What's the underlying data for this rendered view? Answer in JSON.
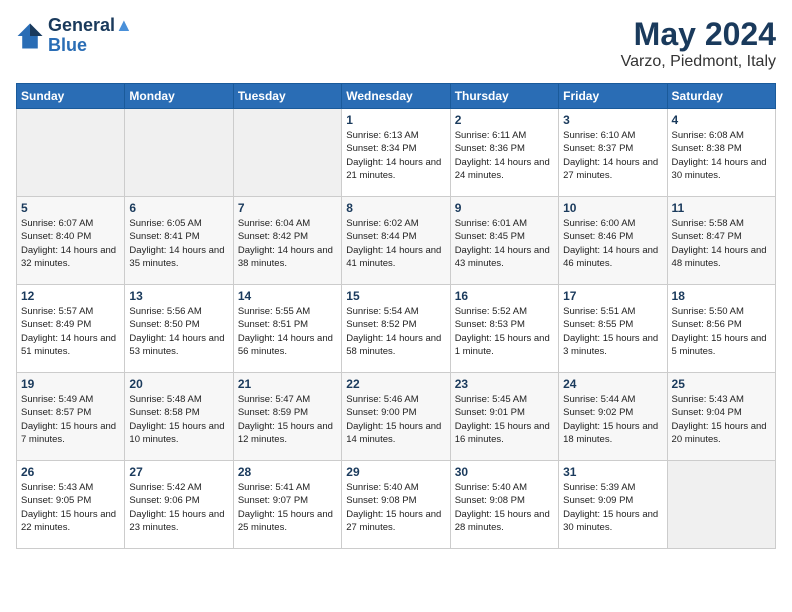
{
  "header": {
    "logo_line1": "General",
    "logo_line2": "Blue",
    "month": "May 2024",
    "location": "Varzo, Piedmont, Italy"
  },
  "days_of_week": [
    "Sunday",
    "Monday",
    "Tuesday",
    "Wednesday",
    "Thursday",
    "Friday",
    "Saturday"
  ],
  "weeks": [
    [
      {
        "day": "",
        "empty": true
      },
      {
        "day": "",
        "empty": true
      },
      {
        "day": "",
        "empty": true
      },
      {
        "day": "1",
        "sunrise": "6:13 AM",
        "sunset": "8:34 PM",
        "daylight": "14 hours and 21 minutes."
      },
      {
        "day": "2",
        "sunrise": "6:11 AM",
        "sunset": "8:36 PM",
        "daylight": "14 hours and 24 minutes."
      },
      {
        "day": "3",
        "sunrise": "6:10 AM",
        "sunset": "8:37 PM",
        "daylight": "14 hours and 27 minutes."
      },
      {
        "day": "4",
        "sunrise": "6:08 AM",
        "sunset": "8:38 PM",
        "daylight": "14 hours and 30 minutes."
      }
    ],
    [
      {
        "day": "5",
        "sunrise": "6:07 AM",
        "sunset": "8:40 PM",
        "daylight": "14 hours and 32 minutes."
      },
      {
        "day": "6",
        "sunrise": "6:05 AM",
        "sunset": "8:41 PM",
        "daylight": "14 hours and 35 minutes."
      },
      {
        "day": "7",
        "sunrise": "6:04 AM",
        "sunset": "8:42 PM",
        "daylight": "14 hours and 38 minutes."
      },
      {
        "day": "8",
        "sunrise": "6:02 AM",
        "sunset": "8:44 PM",
        "daylight": "14 hours and 41 minutes."
      },
      {
        "day": "9",
        "sunrise": "6:01 AM",
        "sunset": "8:45 PM",
        "daylight": "14 hours and 43 minutes."
      },
      {
        "day": "10",
        "sunrise": "6:00 AM",
        "sunset": "8:46 PM",
        "daylight": "14 hours and 46 minutes."
      },
      {
        "day": "11",
        "sunrise": "5:58 AM",
        "sunset": "8:47 PM",
        "daylight": "14 hours and 48 minutes."
      }
    ],
    [
      {
        "day": "12",
        "sunrise": "5:57 AM",
        "sunset": "8:49 PM",
        "daylight": "14 hours and 51 minutes."
      },
      {
        "day": "13",
        "sunrise": "5:56 AM",
        "sunset": "8:50 PM",
        "daylight": "14 hours and 53 minutes."
      },
      {
        "day": "14",
        "sunrise": "5:55 AM",
        "sunset": "8:51 PM",
        "daylight": "14 hours and 56 minutes."
      },
      {
        "day": "15",
        "sunrise": "5:54 AM",
        "sunset": "8:52 PM",
        "daylight": "14 hours and 58 minutes."
      },
      {
        "day": "16",
        "sunrise": "5:52 AM",
        "sunset": "8:53 PM",
        "daylight": "15 hours and 1 minute."
      },
      {
        "day": "17",
        "sunrise": "5:51 AM",
        "sunset": "8:55 PM",
        "daylight": "15 hours and 3 minutes."
      },
      {
        "day": "18",
        "sunrise": "5:50 AM",
        "sunset": "8:56 PM",
        "daylight": "15 hours and 5 minutes."
      }
    ],
    [
      {
        "day": "19",
        "sunrise": "5:49 AM",
        "sunset": "8:57 PM",
        "daylight": "15 hours and 7 minutes."
      },
      {
        "day": "20",
        "sunrise": "5:48 AM",
        "sunset": "8:58 PM",
        "daylight": "15 hours and 10 minutes."
      },
      {
        "day": "21",
        "sunrise": "5:47 AM",
        "sunset": "8:59 PM",
        "daylight": "15 hours and 12 minutes."
      },
      {
        "day": "22",
        "sunrise": "5:46 AM",
        "sunset": "9:00 PM",
        "daylight": "15 hours and 14 minutes."
      },
      {
        "day": "23",
        "sunrise": "5:45 AM",
        "sunset": "9:01 PM",
        "daylight": "15 hours and 16 minutes."
      },
      {
        "day": "24",
        "sunrise": "5:44 AM",
        "sunset": "9:02 PM",
        "daylight": "15 hours and 18 minutes."
      },
      {
        "day": "25",
        "sunrise": "5:43 AM",
        "sunset": "9:04 PM",
        "daylight": "15 hours and 20 minutes."
      }
    ],
    [
      {
        "day": "26",
        "sunrise": "5:43 AM",
        "sunset": "9:05 PM",
        "daylight": "15 hours and 22 minutes."
      },
      {
        "day": "27",
        "sunrise": "5:42 AM",
        "sunset": "9:06 PM",
        "daylight": "15 hours and 23 minutes."
      },
      {
        "day": "28",
        "sunrise": "5:41 AM",
        "sunset": "9:07 PM",
        "daylight": "15 hours and 25 minutes."
      },
      {
        "day": "29",
        "sunrise": "5:40 AM",
        "sunset": "9:08 PM",
        "daylight": "15 hours and 27 minutes."
      },
      {
        "day": "30",
        "sunrise": "5:40 AM",
        "sunset": "9:08 PM",
        "daylight": "15 hours and 28 minutes."
      },
      {
        "day": "31",
        "sunrise": "5:39 AM",
        "sunset": "9:09 PM",
        "daylight": "15 hours and 30 minutes."
      },
      {
        "day": "",
        "empty": true
      }
    ]
  ]
}
